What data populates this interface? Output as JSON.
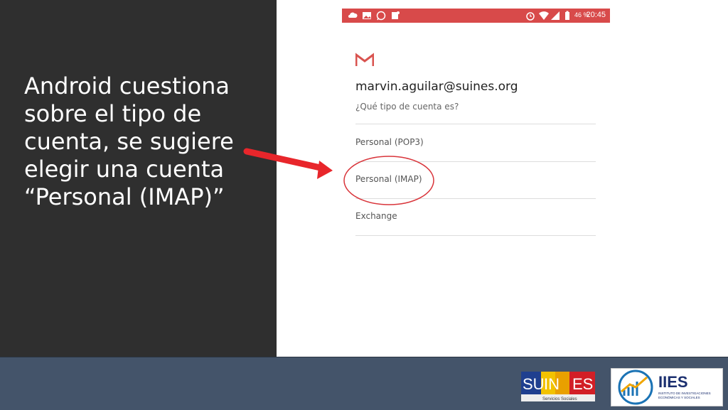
{
  "slide": {
    "text": "Android cuestiona\nsobre el tipo de\ncuenta, se sugiere\nelegir una cuenta\n“Personal (IMAP)”"
  },
  "status_bar": {
    "battery": "46 %",
    "time": "20:45",
    "left_icons": [
      "cloud-icon",
      "image-icon",
      "whatsapp-icon",
      "notification-icon"
    ],
    "right_icons": [
      "alarm-icon",
      "wifi-icon",
      "signal-icon",
      "battery-icon"
    ]
  },
  "account": {
    "email": "marvin.aguilar@suines.org",
    "question": "¿Qué tipo de cuenta es?",
    "options": [
      {
        "label": "Personal (POP3)"
      },
      {
        "label": "Personal (IMAP)"
      },
      {
        "label": "Exchange"
      }
    ]
  },
  "logos": {
    "suines": {
      "text": "SUINES",
      "subtitle": "Servicios Sociales"
    },
    "iies": {
      "title": "IIES",
      "subtitle": "INSTITUTO DE INVESTIGACIONES ECONÓMICAS Y SOCIALES"
    }
  },
  "colors": {
    "left_panel": "#2f2f2f",
    "status_bar": "#d84a4a",
    "bottom_bar": "#44546a",
    "annotation": "#e8262b"
  }
}
